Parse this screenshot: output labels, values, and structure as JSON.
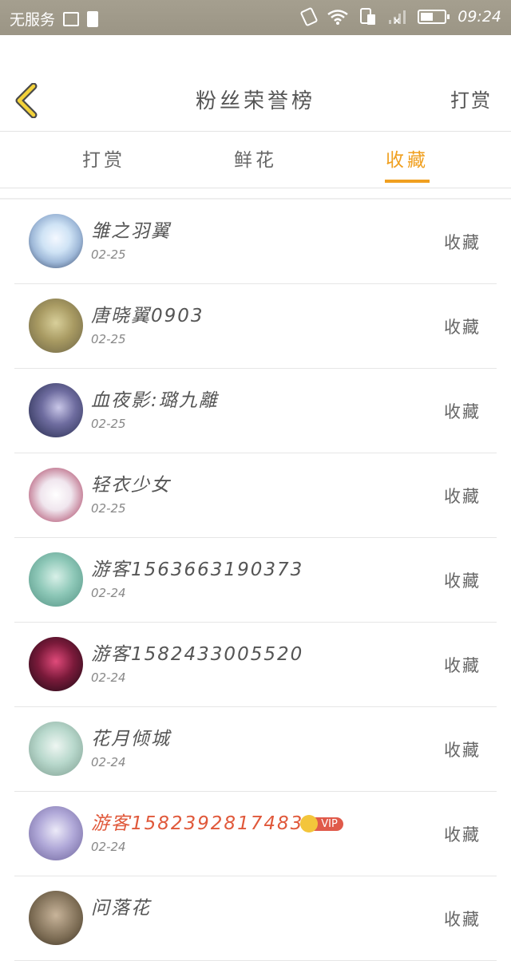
{
  "status_bar": {
    "carrier": "无服务",
    "time": "09:24",
    "battery_level": 0.55
  },
  "header": {
    "title": "粉丝荣誉榜",
    "right_action": "打赏"
  },
  "tabs": [
    {
      "label": "打赏",
      "active": false
    },
    {
      "label": "鲜花",
      "active": false
    },
    {
      "label": "收藏",
      "active": true
    }
  ],
  "colors": {
    "accent": "#f0a020",
    "vip_name": "#e0583a",
    "vip_badge": "#e05a4a"
  },
  "fans": [
    {
      "name": "雏之羽翼",
      "date": "02-25",
      "action": "收藏",
      "vip": false
    },
    {
      "name": "唐晓翼0903",
      "date": "02-25",
      "action": "收藏",
      "vip": false
    },
    {
      "name": "血夜影:璐九離",
      "date": "02-25",
      "action": "收藏",
      "vip": false
    },
    {
      "name": "轻衣少女",
      "date": "02-25",
      "action": "收藏",
      "vip": false
    },
    {
      "name": "游客1563663190373",
      "date": "02-24",
      "action": "收藏",
      "vip": false
    },
    {
      "name": "游客1582433005520",
      "date": "02-24",
      "action": "收藏",
      "vip": false
    },
    {
      "name": "花月倾城",
      "date": "02-24",
      "action": "收藏",
      "vip": false
    },
    {
      "name": "游客1582392817483",
      "date": "02-24",
      "action": "收藏",
      "vip": true,
      "badge": "VIP"
    },
    {
      "name": "问落花",
      "date": "",
      "action": "收藏",
      "vip": false
    }
  ]
}
